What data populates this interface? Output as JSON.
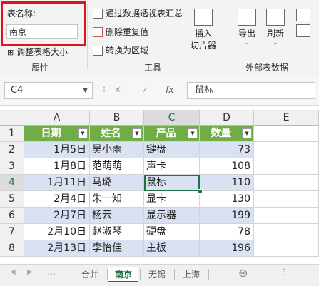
{
  "ribbon": {
    "properties": {
      "table_name_label": "表名称:",
      "table_name_value": "南京",
      "resize_label": "调整表格大小",
      "group_label": "属性"
    },
    "tools": {
      "summarize_pivot": "通过数据透视表汇总",
      "remove_duplicates": "删除重复值",
      "convert_to_range": "转换为区域",
      "insert_slicer_line1": "插入",
      "insert_slicer_line2": "切片器",
      "group_label": "工具"
    },
    "external": {
      "export": "导出",
      "refresh": "刷新",
      "group_label": "外部表数据"
    }
  },
  "formula_bar": {
    "name_box": "C4",
    "cancel_glyph": "✕",
    "enter_glyph": "✓",
    "fx_glyph": "fx",
    "formula_value": "鼠标"
  },
  "sheet": {
    "columns": [
      "A",
      "B",
      "C",
      "D",
      "E"
    ],
    "row_numbers": [
      "1",
      "2",
      "3",
      "4",
      "5",
      "6",
      "7",
      "8"
    ],
    "headers": [
      "日期",
      "姓名",
      "产品",
      "数量"
    ],
    "rows": [
      [
        "1月5日",
        "吴小雨",
        "键盘",
        "73"
      ],
      [
        "1月8日",
        "范萌萌",
        "声卡",
        "108"
      ],
      [
        "1月11日",
        "马璐",
        "鼠标",
        "110"
      ],
      [
        "2月4日",
        "朱一知",
        "显卡",
        "130"
      ],
      [
        "2月7日",
        "杨云",
        "显示器",
        "199"
      ],
      [
        "2月10日",
        "赵淑琴",
        "硬盘",
        "78"
      ],
      [
        "2月13日",
        "李怡佳",
        "主板",
        "196"
      ]
    ],
    "active_cell": "C4"
  },
  "tabs": [
    "合并",
    "南京",
    "无锡",
    "上海"
  ],
  "active_tab": "南京",
  "colors": {
    "header_green": "#70ad47",
    "band_blue": "#d9e1f2",
    "excel_green": "#217346",
    "highlight_red": "#e0141e"
  }
}
